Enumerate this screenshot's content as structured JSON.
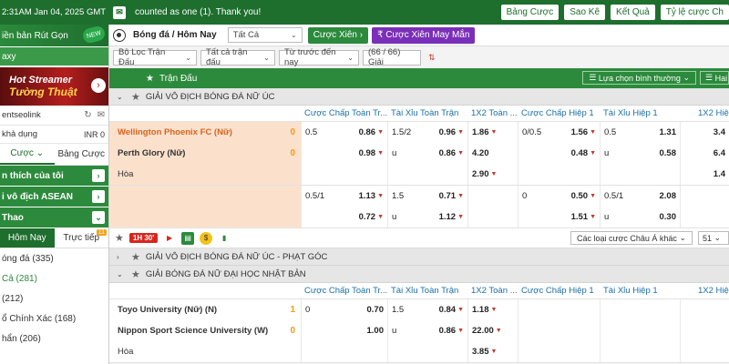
{
  "topbar": {
    "time": "2:31AM Jan 04, 2025 GMT +7",
    "message": "counted as one (1). Thank you!",
    "buttons": [
      "Bảng Cược",
      "Sao Kê",
      "Kết Quả",
      "Tỷ lệ cược Ch"
    ]
  },
  "sidebar": {
    "promo": "iền bản Rút Gọn",
    "promo_badge": "NEW",
    "brand": "axy",
    "banner_line1": "Hot Streamer",
    "banner_line2": "Tường Thuật",
    "username": "entseolink",
    "balance_label": "khả dụng",
    "balance_value": "INR 0",
    "tabs": [
      "Cược",
      "Bảng Cược"
    ],
    "sections": [
      "n thích của tôi",
      "i vô địch ASEAN",
      "Thao"
    ],
    "subtabs": [
      "Hôm Nay",
      "Trực tiếp"
    ],
    "subtab_badge": "11",
    "items": [
      "óng đá (335)",
      "Cả (281)",
      "(212)",
      "ổ Chính Xác (168)",
      "hẩn (206)"
    ]
  },
  "main": {
    "breadcrumb": "Bóng đá / Hôm Nay",
    "filter_all": "Tất Cả",
    "btn_parlay": "Cược Xiên",
    "btn_lucky": "₹ Cược Xiên May Mắn",
    "filter1": "Bộ Lọc Trận Đấu",
    "filter2": "Tất cả trận đấu",
    "filter3": "Từ trước đến nay",
    "filter4": "(66 / 66) Giải",
    "section_title": "Trận Đấu",
    "view_select": "Lựa chọn bình thường",
    "view_select2": "Hai",
    "columns": [
      "Cược Chấp Toàn Tr...",
      "Tài Xỉu Toàn Trận",
      "1X2 Toàn ...",
      "Cược Chấp Hiệp 1",
      "Tài Xỉu Hiệp 1",
      "1X2 Hiệ"
    ],
    "league1": "GIẢI VÔ ĐỊCH BÓNG ĐÁ NỮ ÚC",
    "match1": {
      "home": "Wellington Phoenix FC (Nữ)",
      "away": "Perth Glory (Nữ)",
      "draw": "Hòa",
      "home_score": "0",
      "away_score": "0",
      "hdp": [
        [
          "0.5",
          "0.86"
        ],
        [
          "",
          "0.98"
        ],
        [
          "",
          ""
        ]
      ],
      "ou": [
        [
          "1.5/2",
          "0.96"
        ],
        [
          "u",
          "0.86"
        ],
        [
          "",
          ""
        ]
      ],
      "x12": [
        "1.86",
        "4.20",
        "2.90"
      ],
      "hdp1": [
        [
          "0/0.5",
          "1.56"
        ],
        [
          "",
          "0.48"
        ],
        [
          "",
          ""
        ]
      ],
      "ou1": [
        [
          "0.5",
          "1.31"
        ],
        [
          "u",
          "0.58"
        ],
        [
          "",
          ""
        ]
      ],
      "x121": [
        "3.4",
        "6.4",
        "1.4"
      ],
      "extra_hdp": [
        [
          "0.5/1",
          "1.13"
        ],
        [
          "",
          "0.72"
        ]
      ],
      "extra_ou": [
        [
          "1.5",
          "0.71"
        ],
        [
          "u",
          "1.12"
        ]
      ],
      "extra_hdp1": [
        [
          "0",
          "0.50"
        ],
        [
          "",
          "1.51"
        ]
      ],
      "extra_ou1": [
        [
          "0.5/1",
          "2.08"
        ],
        [
          "u",
          "0.30"
        ]
      ]
    },
    "live_time": "1H 30'",
    "live_select": "Các loại cược Châu Á khác",
    "live_select2": "51",
    "league2": "GIẢI VÔ ĐỊCH BÓNG ĐÁ NỮ ÚC - PHẠT GÓC",
    "league3": "GIẢI BÓNG ĐÁ NỮ ĐẠI HỌC NHẬT BẢN",
    "match2": {
      "home": "Toyo University (Nữ) (N)",
      "away": "Nippon Sport Science University (W)",
      "draw": "Hòa",
      "home_score": "1",
      "away_score": "0",
      "hdp": [
        [
          "0",
          "0.70"
        ],
        [
          "",
          "1.00"
        ],
        [
          "",
          ""
        ]
      ],
      "ou": [
        [
          "1.5",
          "0.84"
        ],
        [
          "u",
          "0.86"
        ],
        [
          "",
          ""
        ]
      ],
      "x12": [
        "1.18",
        "22.00",
        "3.85"
      ]
    }
  }
}
